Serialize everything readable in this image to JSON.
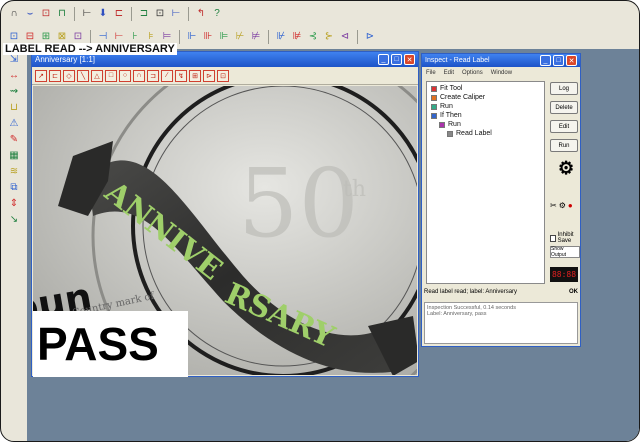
{
  "toolbar_top": [
    "∩",
    "⌣",
    "⊡",
    "⊓",
    "⊢",
    "⬇",
    "⊏",
    "⊐",
    "⊡",
    "⊢",
    "↰",
    "?"
  ],
  "toolbar_second": [
    "⊡",
    "⊟",
    "⊞",
    "⊠",
    "⊡",
    "⊣",
    "⊢",
    "⊦",
    "⊧",
    "⊨",
    "⊩",
    "⊪",
    "⊫",
    "⊬",
    "⊭",
    "⊮",
    "⊯",
    "⊰",
    "⊱",
    "⊲",
    "⊳"
  ],
  "left_tools": [
    "⇲",
    "↔",
    "⇝",
    "⊔",
    "⚠",
    "✎",
    "▦",
    "≋",
    "⧉",
    "⇕",
    "↘"
  ],
  "image_window": {
    "title": "Anniversary [1:1]",
    "tools": [
      "↗",
      "⊏",
      "◇",
      "╲",
      "△",
      "□",
      "○",
      "∩",
      "⊐",
      "∕",
      "↯",
      "⊞",
      "⊳",
      "⊡"
    ],
    "label_read": "LABEL READ --> ANNIVERSARY",
    "result": "PASS"
  },
  "tool_window": {
    "title": "Inspect - Read Label",
    "menu": [
      "File",
      "Edit",
      "Options",
      "Window"
    ],
    "tree": [
      {
        "label": "Fit Tool",
        "indent": 0
      },
      {
        "label": "Create Caliper",
        "indent": 0
      },
      {
        "label": "Run",
        "indent": 0
      },
      {
        "label": "If Then",
        "indent": 0
      },
      {
        "label": "Run",
        "indent": 1
      },
      {
        "label": "Read Label",
        "indent": 2
      }
    ],
    "buttons": [
      "Log",
      "Delete",
      "Edit",
      "Run"
    ],
    "checkbox_label": "Inhibit Save",
    "output_label": "Show Output",
    "led_value": "88:88",
    "status_left": "Read label read; label: Anniversary",
    "status_right": "OK",
    "log_lines": [
      "Inspection Successful, 0.14 seconds",
      "Label: Anniversary, pass"
    ]
  },
  "colors": {
    "titlebar": "#1d53c7",
    "workspace": "#6d8298",
    "pass_text": "#000000"
  }
}
